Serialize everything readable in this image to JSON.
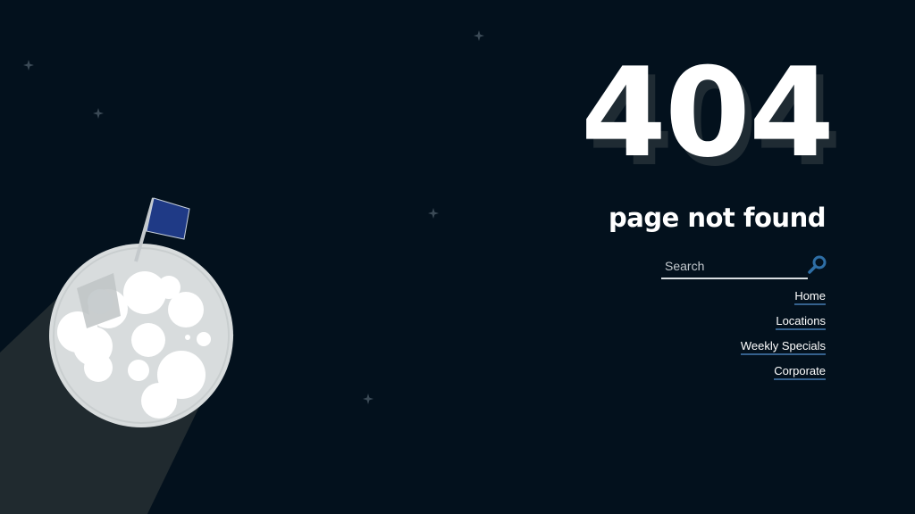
{
  "error": {
    "code": "404",
    "message": "page not found"
  },
  "search": {
    "placeholder": "Search",
    "value": "",
    "icon": "search-icon"
  },
  "nav": {
    "links": [
      {
        "label": "Home"
      },
      {
        "label": "Locations"
      },
      {
        "label": "Weekly Specials"
      },
      {
        "label": "Corporate"
      }
    ]
  },
  "colors": {
    "background": "#03111d",
    "text": "#ffffff",
    "link_underline": "#35618d",
    "search_icon": "#2e6ea5",
    "flag": "#1f3a86",
    "moon": "#d8dcdd",
    "star": "#3b4a56"
  }
}
